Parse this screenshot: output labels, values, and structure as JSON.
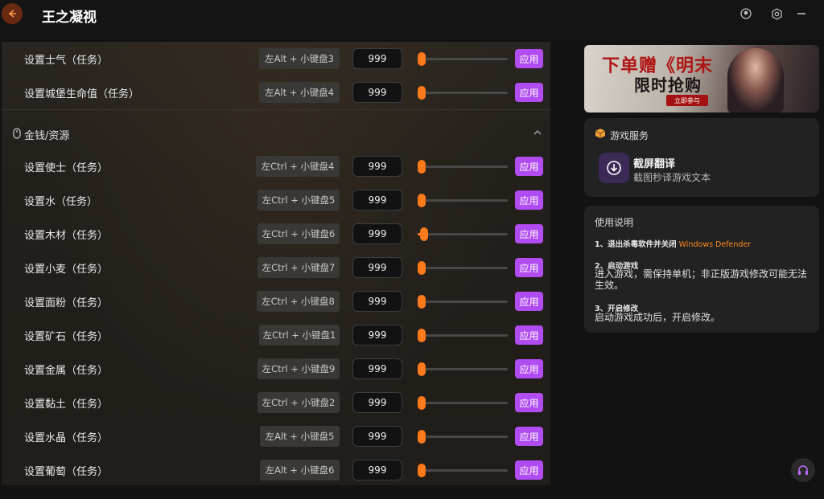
{
  "app": {
    "title": "王之凝视"
  },
  "top_rows": [
    {
      "label": "设置士气（任务）",
      "hotkey": "左Alt + 小键盘3",
      "value": "999",
      "level": 0,
      "apply": "应用"
    },
    {
      "label": "设置城堡生命值（任务）",
      "hotkey": "左Alt + 小键盘4",
      "value": "999",
      "level": 0,
      "apply": "应用"
    }
  ],
  "section": {
    "title": "金钱/资源",
    "rows": [
      {
        "label": "设置使士（任务）",
        "hotkey": "左Ctrl + 小键盘4",
        "value": "999",
        "level": 0,
        "apply": "应用"
      },
      {
        "label": "设置水（任务）",
        "hotkey": "左Ctrl + 小键盘5",
        "value": "999",
        "level": 0,
        "apply": "应用"
      },
      {
        "label": "设置木材（任务）",
        "hotkey": "左Ctrl + 小键盘6",
        "value": "999",
        "level": 0.07,
        "apply": "应用"
      },
      {
        "label": "设置小麦（任务）",
        "hotkey": "左Ctrl + 小键盘7",
        "value": "999",
        "level": 0,
        "apply": "应用"
      },
      {
        "label": "设置面粉（任务）",
        "hotkey": "左Ctrl + 小键盘8",
        "value": "999",
        "level": 0,
        "apply": "应用"
      },
      {
        "label": "设置矿石（任务）",
        "hotkey": "左Ctrl + 小键盘1",
        "value": "999",
        "level": 0,
        "apply": "应用"
      },
      {
        "label": "设置金属（任务）",
        "hotkey": "左Ctrl + 小键盘9",
        "value": "999",
        "level": 0,
        "apply": "应用"
      },
      {
        "label": "设置黏土（任务）",
        "hotkey": "左Ctrl + 小键盘2",
        "value": "999",
        "level": 0,
        "apply": "应用"
      },
      {
        "label": "设置水晶（任务）",
        "hotkey": "左Alt + 小键盘5",
        "value": "999",
        "level": 0,
        "apply": "应用"
      },
      {
        "label": "设置葡萄（任务）",
        "hotkey": "左Alt + 小键盘6",
        "value": "999",
        "level": 0,
        "apply": "应用"
      }
    ]
  },
  "banner": {
    "line1": "下单赠《明末",
    "line2": "限时抢购",
    "button": "立即参与"
  },
  "game_services": {
    "title": "游戏服务",
    "item_name": "截屏翻译",
    "item_desc": "截图秒译游戏文本"
  },
  "instructions": {
    "title": "使用说明",
    "step1_title": "1、退出杀毒软件并关闭",
    "step1_highlight": "Windows Defender",
    "step2_title": "2、启动游戏",
    "step2_text": "进入游戏，需保持单机；非正版游戏修改可能无法生效。",
    "step3_title": "3、开启修改",
    "step3_text": "启动游戏成功后，开启修改。"
  },
  "colors": {
    "accent_orange": "#ff7a1a",
    "apply_purple": "#b14bf2",
    "highlight": "#ff8a1e"
  },
  "icons": {
    "back": "arrow-left-icon",
    "user": "user-icon",
    "settings": "gear-icon",
    "minimize": "minimize-icon",
    "section": "mouse-icon",
    "collapse": "chevron-up-icon",
    "service": "box-icon",
    "download": "download-icon",
    "support": "headset-icon"
  }
}
